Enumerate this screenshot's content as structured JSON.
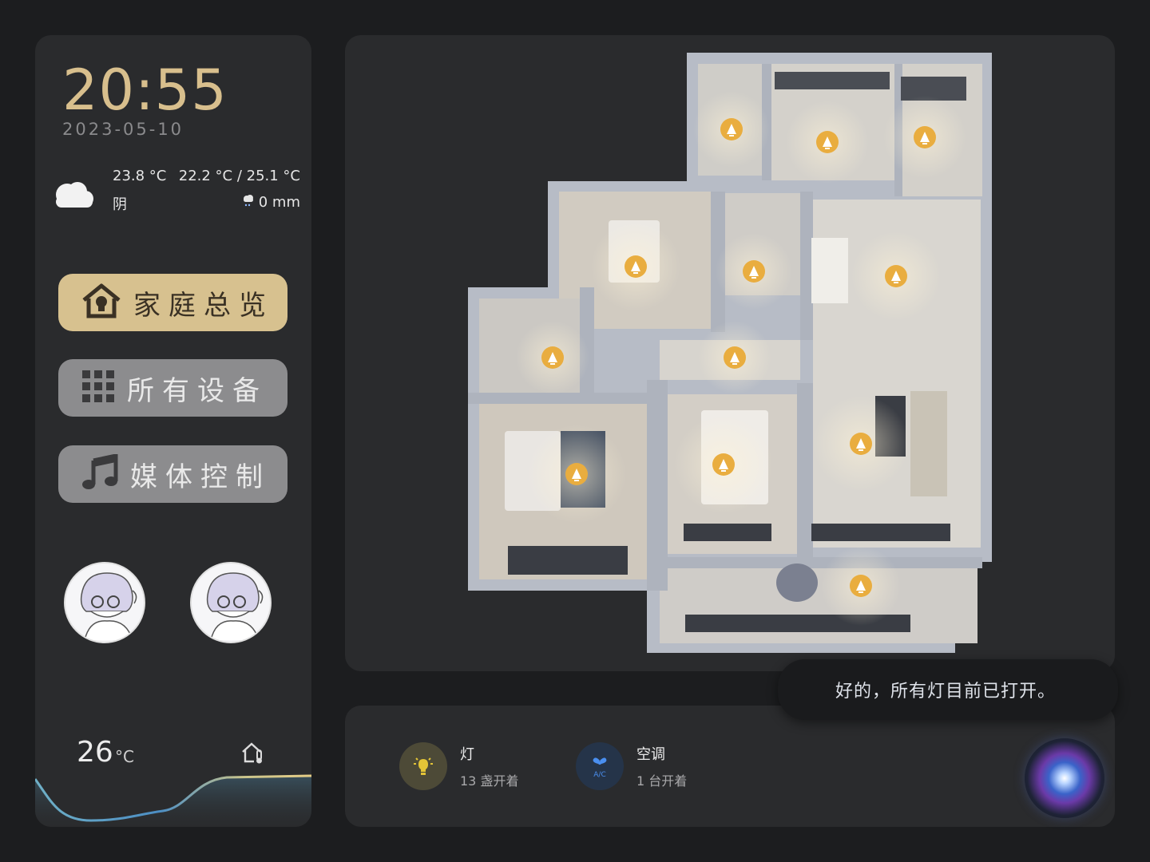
{
  "sidebar": {
    "time": "20:55",
    "date": "2023-05-10",
    "weather": {
      "icon": "cloud-icon",
      "current_temp": "23.8 °C",
      "condition": "阴",
      "temp_range": "22.2 °C / 25.1 °C",
      "precipitation": "0 mm"
    },
    "nav": [
      {
        "label": "家庭总览",
        "icon": "home-bulb-icon",
        "active": true
      },
      {
        "label": "所有设备",
        "icon": "grid-icon",
        "active": false
      },
      {
        "label": "媒体控制",
        "icon": "music-note-icon",
        "active": false
      }
    ],
    "indoor_temp": {
      "value": "26",
      "unit": "°C",
      "icon": "home-thermometer-icon"
    }
  },
  "devices": [
    {
      "name": "灯",
      "status": "13 盏开着",
      "icon": "lightbulb-icon",
      "color": "#e3c437"
    },
    {
      "name": "空调",
      "status": "1 台开着",
      "icon": "ac-fan-icon",
      "color": "#4a8ff0"
    }
  ],
  "assistant": {
    "message": "好的，所有灯目前已打开。",
    "icon": "siri-orb-icon"
  },
  "colors": {
    "accent_gold": "#d7c18f",
    "light_marker": "#e9ad3f",
    "panel_bg": "#2a2b2d"
  }
}
